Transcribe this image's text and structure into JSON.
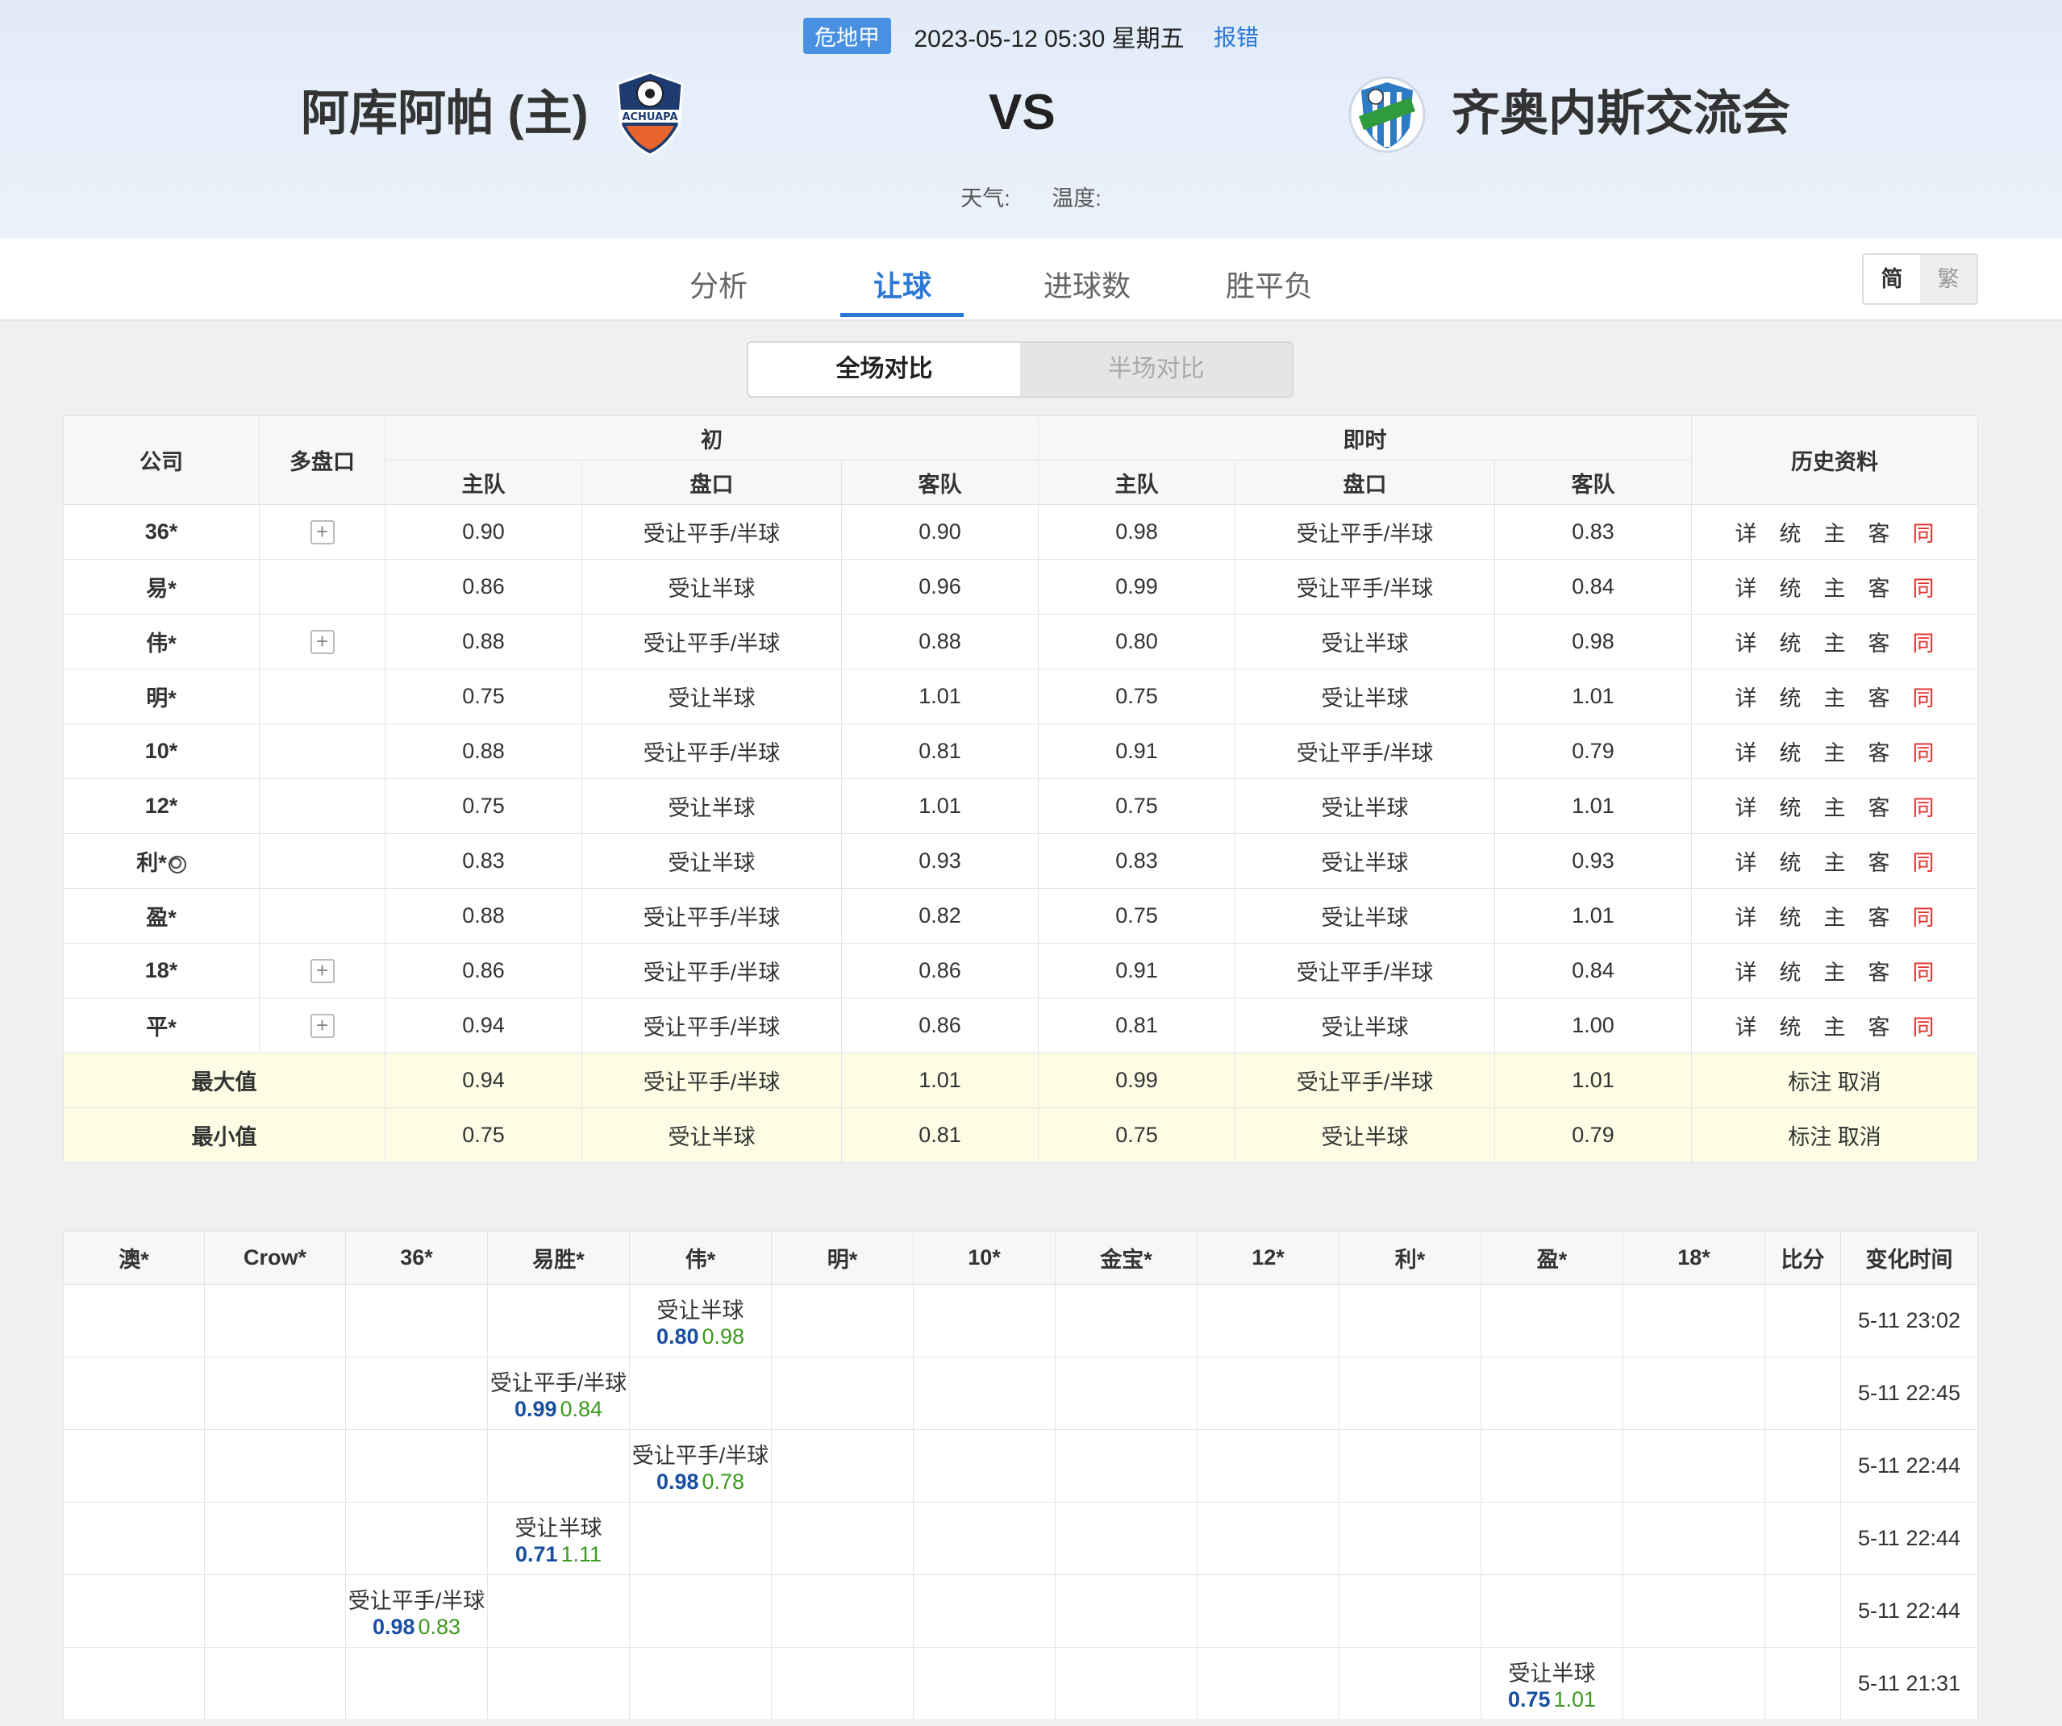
{
  "header": {
    "league": "危地甲",
    "datetime": "2023-05-12 05:30 星期五",
    "report_label": "报错",
    "home_team": "阿库阿帕 (主)",
    "away_team": "齐奥内斯交流会",
    "vs": "VS",
    "weather_label": "天气:",
    "temp_label": "温度:",
    "home_logo_text": "ACHUAPA"
  },
  "nav": {
    "tabs": [
      "分析",
      "让球",
      "进球数",
      "胜平负"
    ],
    "lang_simplified": "简",
    "lang_traditional": "繁"
  },
  "segment": {
    "full": "全场对比",
    "half": "半场对比"
  },
  "odds_table": {
    "headers": {
      "company": "公司",
      "multi": "多盘口",
      "initial": "初",
      "live": "即时",
      "history": "历史资料",
      "home": "主队",
      "line": "盘口",
      "away": "客队"
    },
    "history_links": [
      "详",
      "统",
      "主",
      "客",
      "同"
    ],
    "rows": [
      {
        "company": "36*",
        "plus": true,
        "i_home": "0.90",
        "i_line": "受让平手/半球",
        "i_away": "0.90",
        "l_home": "0.98",
        "l_line": "受让平手/半球",
        "l_away": "0.83"
      },
      {
        "company": "易*",
        "plus": false,
        "i_home": "0.86",
        "i_line": "受让半球",
        "i_away": "0.96",
        "l_home": "0.99",
        "l_line": "受让平手/半球",
        "l_away": "0.84"
      },
      {
        "company": "伟*",
        "plus": true,
        "i_home": "0.88",
        "i_line": "受让平手/半球",
        "i_away": "0.88",
        "l_home": "0.80",
        "l_line": "受让半球",
        "l_away": "0.98"
      },
      {
        "company": "明*",
        "plus": false,
        "i_home": "0.75",
        "i_line": "受让半球",
        "i_away": "1.01",
        "l_home": "0.75",
        "l_line": "受让半球",
        "l_away": "1.01"
      },
      {
        "company": "10*",
        "plus": false,
        "i_home": "0.88",
        "i_line": "受让平手/半球",
        "i_away": "0.81",
        "l_home": "0.91",
        "l_line": "受让平手/半球",
        "l_away": "0.79"
      },
      {
        "company": "12*",
        "plus": false,
        "i_home": "0.75",
        "i_line": "受让半球",
        "i_away": "1.01",
        "l_home": "0.75",
        "l_line": "受让半球",
        "l_away": "1.01"
      },
      {
        "company": "利*",
        "plus": false,
        "ball": true,
        "i_home": "0.83",
        "i_line": "受让半球",
        "i_away": "0.93",
        "l_home": "0.83",
        "l_line": "受让半球",
        "l_away": "0.93"
      },
      {
        "company": "盈*",
        "plus": false,
        "i_home": "0.88",
        "i_line": "受让平手/半球",
        "i_away": "0.82",
        "l_home": "0.75",
        "l_line": "受让半球",
        "l_away": "1.01"
      },
      {
        "company": "18*",
        "plus": true,
        "i_home": "0.86",
        "i_line": "受让平手/半球",
        "i_away": "0.86",
        "l_home": "0.91",
        "l_line": "受让平手/半球",
        "l_away": "0.84"
      },
      {
        "company": "平*",
        "plus": true,
        "i_home": "0.94",
        "i_line": "受让平手/半球",
        "i_away": "0.86",
        "l_home": "0.81",
        "l_line": "受让半球",
        "l_away": "1.00"
      }
    ],
    "summary": [
      {
        "label": "最大值",
        "i_home": "0.94",
        "i_line": "受让平手/半球",
        "i_away": "1.01",
        "l_home": "0.99",
        "l_line": "受让平手/半球",
        "l_away": "1.01",
        "action1": "标注",
        "action2": "取消"
      },
      {
        "label": "最小值",
        "i_home": "0.75",
        "i_line": "受让半球",
        "i_away": "0.81",
        "l_home": "0.75",
        "l_line": "受让半球",
        "l_away": "0.79",
        "action1": "标注",
        "action2": "取消"
      }
    ]
  },
  "changes_table": {
    "headers": [
      "澳*",
      "Crow*",
      "36*",
      "易胜*",
      "伟*",
      "明*",
      "10*",
      "金宝*",
      "12*",
      "利*",
      "盈*",
      "18*",
      "比分",
      "变化时间"
    ],
    "rows": [
      {
        "col": 4,
        "line": "受让半球",
        "o1": "0.80",
        "o2": "0.98",
        "time": "5-11 23:02"
      },
      {
        "col": 3,
        "line": "受让平手/半球",
        "o1": "0.99",
        "o2": "0.84",
        "time": "5-11 22:45"
      },
      {
        "col": 4,
        "line": "受让平手/半球",
        "o1": "0.98",
        "o2": "0.78",
        "time": "5-11 22:44"
      },
      {
        "col": 3,
        "line": "受让半球",
        "o1": "0.71",
        "o2": "1.11",
        "time": "5-11 22:44"
      },
      {
        "col": 2,
        "line": "受让平手/半球",
        "o1": "0.98",
        "o2": "0.83",
        "time": "5-11 22:44"
      },
      {
        "col": 10,
        "line": "受让半球",
        "o1": "0.75",
        "o2": "1.01",
        "time": "5-11 21:31"
      }
    ]
  }
}
